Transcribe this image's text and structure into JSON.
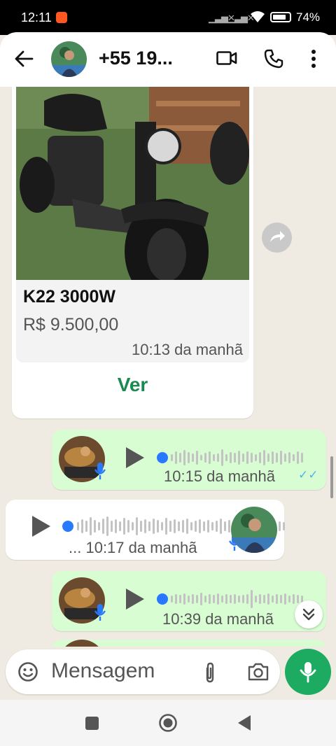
{
  "status_bar": {
    "time": "12:11",
    "battery": "74%"
  },
  "header": {
    "contact_name": "+55 19..."
  },
  "product": {
    "name": "K22 3000W",
    "price": "R$ 9.500,00",
    "time": "10:13 da manhã",
    "action": "Ver"
  },
  "messages": [
    {
      "direction": "outgoing",
      "prefix": "",
      "time": "10:15 da manhã",
      "ticks": "✓✓"
    },
    {
      "direction": "incoming",
      "prefix": "...",
      "time": "10:17 da manhã"
    },
    {
      "direction": "outgoing",
      "prefix": "",
      "time": "10:39 da manhã"
    }
  ],
  "composer": {
    "placeholder": "Mensagem"
  },
  "colors": {
    "accent": "#1daa61",
    "outgoing_bubble": "#d9fdd3",
    "background": "#efeae2",
    "link": "#1a8a50",
    "play_dot": "#2979ff"
  },
  "icons": [
    "back-arrow-icon",
    "video-call-icon",
    "phone-icon",
    "more-vert-icon",
    "forward-icon",
    "mic-icon",
    "play-icon",
    "emoji-icon",
    "attach-icon",
    "camera-icon",
    "scroll-down-icon",
    "nav-square-icon",
    "nav-home-icon",
    "nav-back-icon"
  ]
}
